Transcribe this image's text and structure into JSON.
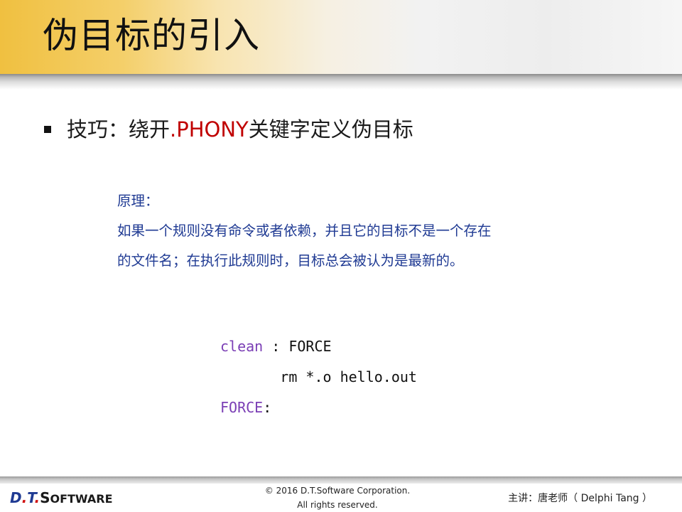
{
  "header": {
    "title": "伪目标的引入"
  },
  "bullet": {
    "prefix": "技巧：绕开 ",
    "keyword": ".PHONY",
    "suffix": " 关键字定义伪目标"
  },
  "principle": {
    "heading": "原理：",
    "line1": "如果一个规则没有命令或者依赖，并且它的目标不是一个存在",
    "line2": "的文件名；在执行此规则时，目标总会被认为是最新的。"
  },
  "code": {
    "line1_target": "clean",
    "line1_rest": " : FORCE",
    "line2": "       rm *.o hello.out",
    "line3_target": "FORCE",
    "line3_rest": ":"
  },
  "footer": {
    "logo_d": "D",
    "logo_dot1": ".",
    "logo_t": "T",
    "logo_dot2": ".",
    "logo_s": "S",
    "logo_oftware": "OFTWARE",
    "copyright_line1": "© 2016 D.T.Software Corporation.",
    "copyright_line2": "All rights reserved.",
    "lecturer": "主讲：唐老师（ Delphi Tang ）"
  },
  "colors": {
    "title_band": "#f0c040",
    "phony": "#c00000",
    "principle_text": "#1f3a93",
    "code_keyword": "#7b3fb5"
  }
}
